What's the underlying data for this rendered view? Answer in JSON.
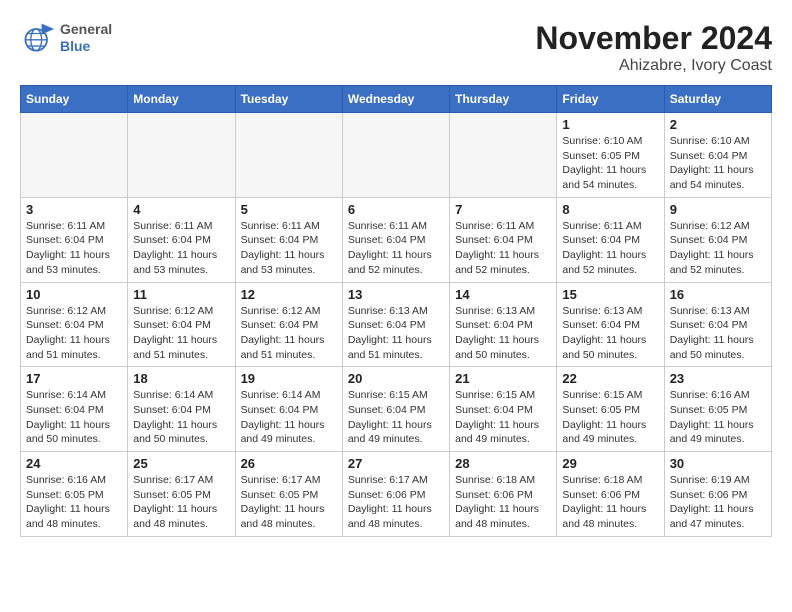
{
  "header": {
    "logo_general": "General",
    "logo_blue": "Blue",
    "month_title": "November 2024",
    "location": "Ahizabre, Ivory Coast"
  },
  "days_of_week": [
    "Sunday",
    "Monday",
    "Tuesday",
    "Wednesday",
    "Thursday",
    "Friday",
    "Saturday"
  ],
  "weeks": [
    [
      {
        "day": "",
        "info": ""
      },
      {
        "day": "",
        "info": ""
      },
      {
        "day": "",
        "info": ""
      },
      {
        "day": "",
        "info": ""
      },
      {
        "day": "",
        "info": ""
      },
      {
        "day": "1",
        "info": "Sunrise: 6:10 AM\nSunset: 6:05 PM\nDaylight: 11 hours and 54 minutes."
      },
      {
        "day": "2",
        "info": "Sunrise: 6:10 AM\nSunset: 6:04 PM\nDaylight: 11 hours and 54 minutes."
      }
    ],
    [
      {
        "day": "3",
        "info": "Sunrise: 6:11 AM\nSunset: 6:04 PM\nDaylight: 11 hours and 53 minutes."
      },
      {
        "day": "4",
        "info": "Sunrise: 6:11 AM\nSunset: 6:04 PM\nDaylight: 11 hours and 53 minutes."
      },
      {
        "day": "5",
        "info": "Sunrise: 6:11 AM\nSunset: 6:04 PM\nDaylight: 11 hours and 53 minutes."
      },
      {
        "day": "6",
        "info": "Sunrise: 6:11 AM\nSunset: 6:04 PM\nDaylight: 11 hours and 52 minutes."
      },
      {
        "day": "7",
        "info": "Sunrise: 6:11 AM\nSunset: 6:04 PM\nDaylight: 11 hours and 52 minutes."
      },
      {
        "day": "8",
        "info": "Sunrise: 6:11 AM\nSunset: 6:04 PM\nDaylight: 11 hours and 52 minutes."
      },
      {
        "day": "9",
        "info": "Sunrise: 6:12 AM\nSunset: 6:04 PM\nDaylight: 11 hours and 52 minutes."
      }
    ],
    [
      {
        "day": "10",
        "info": "Sunrise: 6:12 AM\nSunset: 6:04 PM\nDaylight: 11 hours and 51 minutes."
      },
      {
        "day": "11",
        "info": "Sunrise: 6:12 AM\nSunset: 6:04 PM\nDaylight: 11 hours and 51 minutes."
      },
      {
        "day": "12",
        "info": "Sunrise: 6:12 AM\nSunset: 6:04 PM\nDaylight: 11 hours and 51 minutes."
      },
      {
        "day": "13",
        "info": "Sunrise: 6:13 AM\nSunset: 6:04 PM\nDaylight: 11 hours and 51 minutes."
      },
      {
        "day": "14",
        "info": "Sunrise: 6:13 AM\nSunset: 6:04 PM\nDaylight: 11 hours and 50 minutes."
      },
      {
        "day": "15",
        "info": "Sunrise: 6:13 AM\nSunset: 6:04 PM\nDaylight: 11 hours and 50 minutes."
      },
      {
        "day": "16",
        "info": "Sunrise: 6:13 AM\nSunset: 6:04 PM\nDaylight: 11 hours and 50 minutes."
      }
    ],
    [
      {
        "day": "17",
        "info": "Sunrise: 6:14 AM\nSunset: 6:04 PM\nDaylight: 11 hours and 50 minutes."
      },
      {
        "day": "18",
        "info": "Sunrise: 6:14 AM\nSunset: 6:04 PM\nDaylight: 11 hours and 50 minutes."
      },
      {
        "day": "19",
        "info": "Sunrise: 6:14 AM\nSunset: 6:04 PM\nDaylight: 11 hours and 49 minutes."
      },
      {
        "day": "20",
        "info": "Sunrise: 6:15 AM\nSunset: 6:04 PM\nDaylight: 11 hours and 49 minutes."
      },
      {
        "day": "21",
        "info": "Sunrise: 6:15 AM\nSunset: 6:04 PM\nDaylight: 11 hours and 49 minutes."
      },
      {
        "day": "22",
        "info": "Sunrise: 6:15 AM\nSunset: 6:05 PM\nDaylight: 11 hours and 49 minutes."
      },
      {
        "day": "23",
        "info": "Sunrise: 6:16 AM\nSunset: 6:05 PM\nDaylight: 11 hours and 49 minutes."
      }
    ],
    [
      {
        "day": "24",
        "info": "Sunrise: 6:16 AM\nSunset: 6:05 PM\nDaylight: 11 hours and 48 minutes."
      },
      {
        "day": "25",
        "info": "Sunrise: 6:17 AM\nSunset: 6:05 PM\nDaylight: 11 hours and 48 minutes."
      },
      {
        "day": "26",
        "info": "Sunrise: 6:17 AM\nSunset: 6:05 PM\nDaylight: 11 hours and 48 minutes."
      },
      {
        "day": "27",
        "info": "Sunrise: 6:17 AM\nSunset: 6:06 PM\nDaylight: 11 hours and 48 minutes."
      },
      {
        "day": "28",
        "info": "Sunrise: 6:18 AM\nSunset: 6:06 PM\nDaylight: 11 hours and 48 minutes."
      },
      {
        "day": "29",
        "info": "Sunrise: 6:18 AM\nSunset: 6:06 PM\nDaylight: 11 hours and 48 minutes."
      },
      {
        "day": "30",
        "info": "Sunrise: 6:19 AM\nSunset: 6:06 PM\nDaylight: 11 hours and 47 minutes."
      }
    ]
  ]
}
